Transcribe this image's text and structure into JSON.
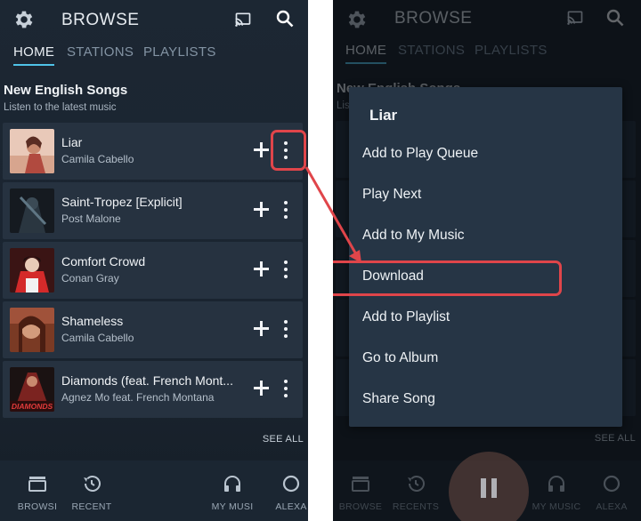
{
  "left_screen": {
    "app_title": "BROWSE",
    "tabs": [
      "HOME",
      "STATIONS",
      "PLAYLISTS"
    ],
    "section_title": "New English Songs",
    "section_subtitle": "Listen to the latest music",
    "songs": [
      {
        "title": "Liar",
        "artist": "Camila Cabello"
      },
      {
        "title": "Saint-Tropez [Explicit]",
        "artist": "Post Malone"
      },
      {
        "title": "Comfort Crowd",
        "artist": "Conan Gray"
      },
      {
        "title": "Shameless",
        "artist": "Camila Cabello"
      },
      {
        "title": "Diamonds (feat. French Mont...",
        "artist": "Agnez Mo feat. French Montana"
      }
    ],
    "see_all": "SEE ALL",
    "bottom_nav": [
      "BROWSI",
      "RECENT",
      "MY MUSI",
      "ALEXA"
    ],
    "album_art_text_diamonds": "DIAMONDS"
  },
  "right_screen": {
    "app_title": "BROWSE",
    "tabs": [
      "HOME",
      "STATIONS",
      "PLAYLISTS"
    ],
    "section_title_partial": "New English Songs",
    "section_subtitle_partial": "Lis",
    "menu": {
      "title": "Liar",
      "items": [
        "Add to Play Queue",
        "Play Next",
        "Add to My Music",
        "Download",
        "Add to Playlist",
        "Go to Album",
        "Share Song"
      ]
    },
    "see_all": "SEE ALL",
    "bottom_nav": [
      "BROWSE",
      "RECENTS",
      "MY MUSIC",
      "ALEXA"
    ]
  },
  "colors": {
    "accent": "#4fc3e8",
    "highlight": "#e0454a",
    "menu_bg": "#263545",
    "row_bg": "#263240"
  }
}
